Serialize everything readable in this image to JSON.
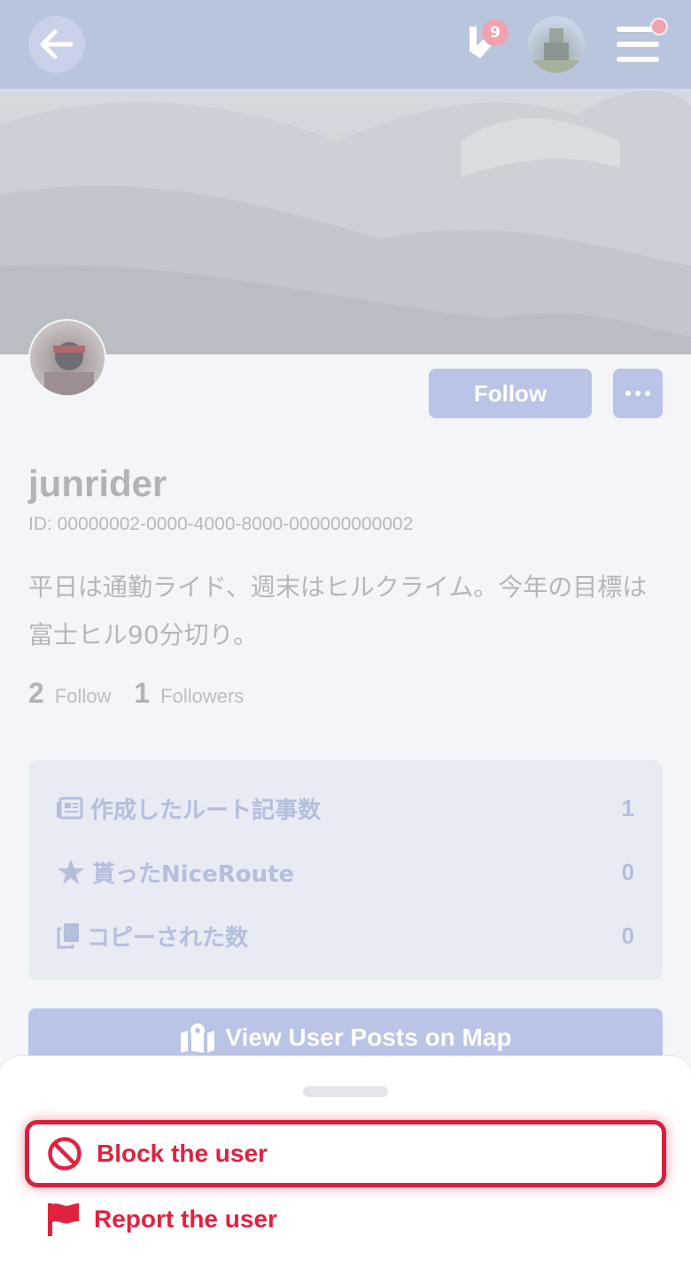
{
  "header": {
    "back_icon": "arrow-left-icon",
    "notification_icon": "brand-notification-icon",
    "notification_count": "9",
    "menu_icon": "hamburger-menu-icon"
  },
  "profile": {
    "follow_label": "Follow",
    "more_icon": "ellipsis-icon",
    "username": "junrider",
    "user_id": "ID: 00000002-0000-4000-8000-000000000002",
    "bio": "平日は通勤ライド、週末はヒルクライム。今年の目標は富士ヒル90分切り。",
    "following_count": "2",
    "following_label": "Follow",
    "followers_count": "1",
    "followers_label": "Followers"
  },
  "stats": [
    {
      "icon": "article-icon",
      "label": "作成したルート記事数",
      "value": "1"
    },
    {
      "icon": "star-icon",
      "label": "貰ったNiceRoute",
      "value": "0"
    },
    {
      "icon": "copy-icon",
      "label": "コピーされた数",
      "value": "0"
    }
  ],
  "map_button": {
    "icon": "map-marker-icon",
    "label": "View User Posts on Map"
  },
  "sheet": {
    "block_label": "Block the user",
    "block_icon": "ban-icon",
    "report_label": "Report the user",
    "report_icon": "flag-icon"
  },
  "colors": {
    "danger": "#e0223f",
    "header": "#b9c4dd",
    "button": "#b9c4e6"
  }
}
